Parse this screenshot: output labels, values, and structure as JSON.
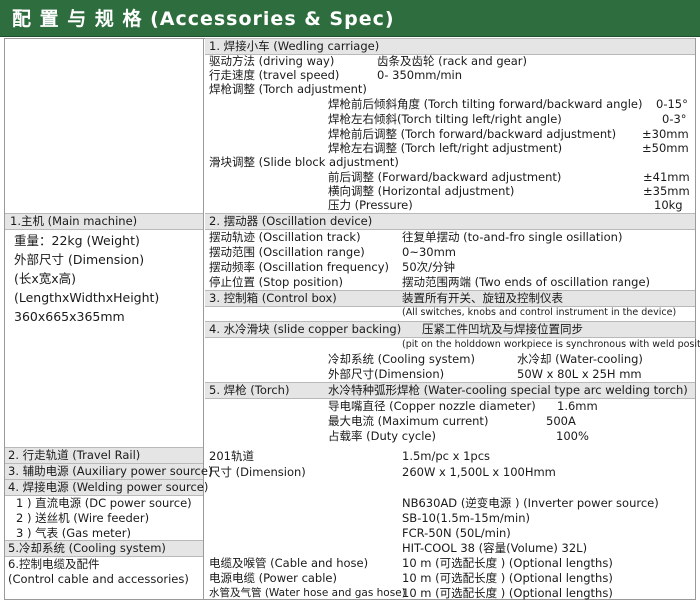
{
  "header": {
    "title": "配 置 与 规 格 (Accessories & Spec)"
  },
  "left": {
    "main_machine": "1.主机 (Main machine)",
    "weight": "重量：22kg (Weight)",
    "dimension": "外部尺寸 (Dimension)",
    "dimension_cn": "(长x宽x高)",
    "dimension_en": "(LengthxWidthxHeight)",
    "dimension_value": "360x665x365mm",
    "travel_rail": "2. 行走轨道 (Travel Rail)",
    "aux_power": "3. 辅助电源 (Auxiliary power source)",
    "welding_power": "4. 焊接电源 (Welding power source)",
    "dc_power": "1 ) 直流电源 (DC power source)",
    "wire_feeder": "2 ) 送丝机 (Wire feeder)",
    "gas_meter": "3 ) 气表 (Gas meter)",
    "cooling_system": "5.冷却系统 (Cooling system)",
    "control_cable_cn": "6.控制电缆及配件",
    "control_cable_en": "(Control cable and accessories)"
  },
  "carriage": {
    "title": "1. 焊接小车 (Wedling carriage)",
    "driving_way": "驱动方法 (driving way)",
    "driving_way_value": "齿条及齿轮 (rack and gear)",
    "travel_speed": "行走速度 (travel speed)",
    "travel_speed_value": "0- 350mm/min",
    "torch_adjustment": "焊枪调整 (Torch adjustment)",
    "tilt_fb": "焊枪前后倾斜角度 (Torch tilting forward/backward angle)",
    "tilt_fb_value": "0-15°",
    "tilt_lr": "焊枪左右倾斜(Torch tilting  left/right angle)",
    "tilt_lr_value": "0-3°",
    "adjust_fb": "焊枪前后调整 (Torch forward/backward adjustment)",
    "adjust_fb_value": "±30mm",
    "adjust_lr": "焊枪左右调整 (Torch left/right adjustment)",
    "adjust_lr_value": "±50mm",
    "slide_block": "滑块调整 (Slide block adjustment)",
    "slide_fb": "前后调整 (Forward/backward adjustment)",
    "slide_fb_value": "±41mm",
    "slide_h": "横向调整 (Horizontal adjustment)",
    "slide_h_value": "±35mm",
    "pressure": "压力 (Pressure)",
    "pressure_value": "10kg"
  },
  "oscillation": {
    "title": "2. 摆动器 (Oscillation device)",
    "track": "摆动轨迹 (Oscillation track)",
    "track_value": "往复单摆动 (to-and-fro single osillation)",
    "range": "摆动范围 (Oscillation range)",
    "range_value": "0~30mm",
    "frequency": "摆动频率 (Oscillation frequency)",
    "frequency_value": "50次/分钟",
    "stop": "停止位置 (Stop position)",
    "stop_value": "摆动范围两端 (Two ends of oscillation range)"
  },
  "control_box": {
    "title": "3. 控制箱 (Control box)",
    "desc_cn": "装置所有开关、旋钮及控制仪表",
    "desc_en": "(All switches, knobs and control instrument in the device)"
  },
  "copper": {
    "title": "4. 水冷滑块 (slide copper backing)",
    "desc_cn": "压紧工件凹坑及与焊接位置同步",
    "desc_en": "(pit on the holddown workpiece is synchronous with weld position)",
    "cooling": "冷却系统 (Cooling system)",
    "cooling_value": "水冷却 (Water-cooling)",
    "dimension": "外部尺寸(Dimension)",
    "dimension_value": "50W x 80L x 25H mm"
  },
  "torch": {
    "title": "5. 焊枪 (Torch)",
    "desc": "水冷特种弧形焊枪 (Water-cooling special type arc welding torch)",
    "nozzle": "导电嘴直径 (Copper nozzle diameter)",
    "nozzle_value": "1.6mm",
    "current": "最大电流 (Maximum current)",
    "current_value": "500A",
    "duty": "占载率 (Duty cycle)",
    "duty_value": "100%"
  },
  "rail": {
    "model": "201轨道",
    "qty": "1.5m/pc x 1pcs",
    "dimension": "尺寸 (Dimension)",
    "dimension_value": "260W x 1,500L x 100Hmm"
  },
  "power": {
    "inverter": "NB630AD (逆变电源 ) (Inverter power source)",
    "feeder": "SB-10(1.5m-15m/min)",
    "gas": "FCR-50N (50L/min)",
    "cool": "HIT-COOL 38  (容量(Volume) 32L)"
  },
  "cables": {
    "cable_hose": "电缆及喉管 (Cable and hose)",
    "cable_hose_value": "10 m (可选配长度 ) (Optional lengths)",
    "power_cable": "电源电缆 (Power cable)",
    "power_cable_value": "10 m (可选配长度 ) (Optional lengths)",
    "water_gas": "水管及气管 (Water hose and gas hose)",
    "water_gas_value": "10 m (可选配长度 ) (Optional lengths)"
  }
}
